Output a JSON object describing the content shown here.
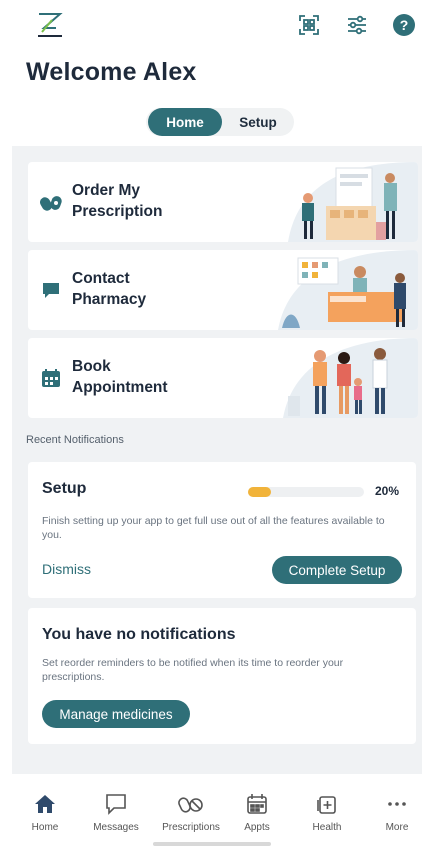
{
  "header": {
    "welcome": "Welcome Alex",
    "icons": [
      "logo-icon",
      "qr-code-icon",
      "sliders-icon",
      "help-icon"
    ],
    "help_glyph": "?"
  },
  "segmented": {
    "home_label": "Home",
    "setup_label": "Setup",
    "active": "Home"
  },
  "cards": [
    {
      "line1": "Order My",
      "line2": "Prescription",
      "icon": "pills-icon"
    },
    {
      "line1": "Contact",
      "line2": "Pharmacy",
      "icon": "chat-icon"
    },
    {
      "line1": "Book",
      "line2": "Appointment",
      "icon": "calendar-icon"
    }
  ],
  "notifications": {
    "section_label": "Recent Notifications",
    "setup": {
      "title": "Setup",
      "progress_percent": 20,
      "progress_label": "20%",
      "description": "Finish setting up your app to get full use out of all the features available to you.",
      "dismiss_label": "Dismiss",
      "complete_label": "Complete Setup"
    },
    "empty": {
      "title": "You have no notifications",
      "description": "Set reorder reminders to be notified when its time to reorder your prescriptions.",
      "manage_label": "Manage medicines"
    }
  },
  "bottom_nav": [
    {
      "label": "Home",
      "icon": "home-icon",
      "active": true
    },
    {
      "label": "Messages",
      "icon": "message-icon"
    },
    {
      "label": "Prescriptions",
      "icon": "pills-icon"
    },
    {
      "label": "Appts",
      "icon": "calendar-icon"
    },
    {
      "label": "Health",
      "icon": "health-plus-icon"
    },
    {
      "label": "More",
      "icon": "more-dots-icon"
    }
  ],
  "colors": {
    "accent": "#2f6f78",
    "progress": "#f1b33a",
    "background": "#f0f2f4"
  }
}
